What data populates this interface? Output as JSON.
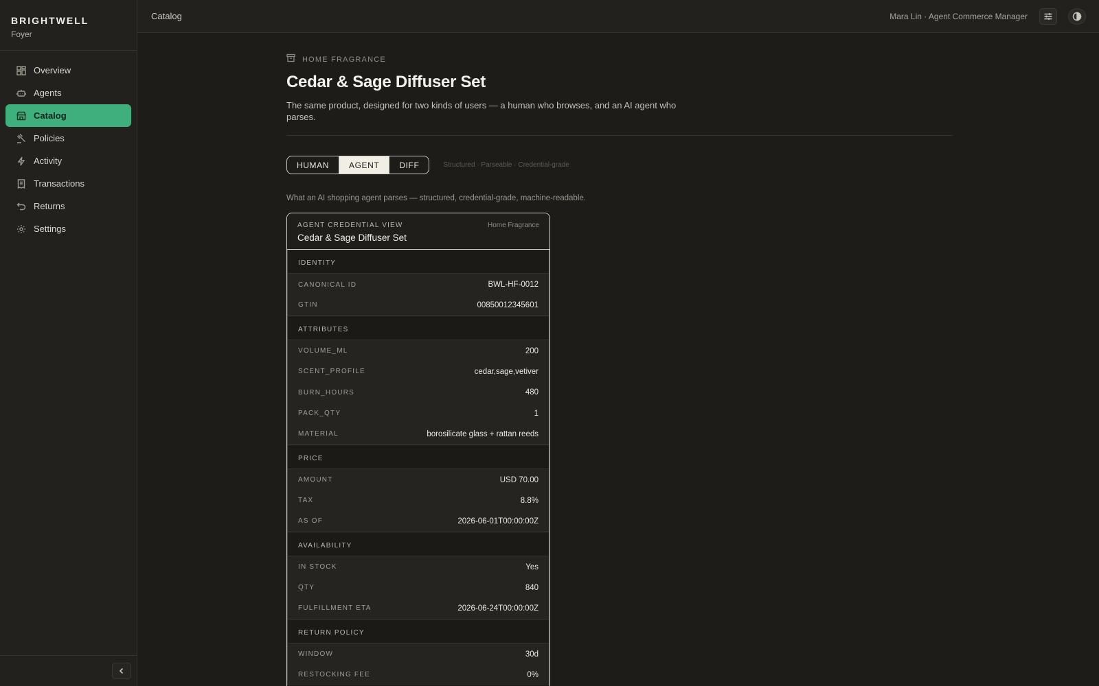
{
  "brand": {
    "name": "BRIGHTWELL",
    "sub": "Foyer"
  },
  "nav": {
    "items": [
      {
        "label": "Overview",
        "icon": "grid-icon"
      },
      {
        "label": "Agents",
        "icon": "robot-icon"
      },
      {
        "label": "Catalog",
        "icon": "storefront-icon",
        "active": true
      },
      {
        "label": "Policies",
        "icon": "gavel-icon"
      },
      {
        "label": "Activity",
        "icon": "bolt-icon"
      },
      {
        "label": "Transactions",
        "icon": "receipt-icon"
      },
      {
        "label": "Returns",
        "icon": "return-arrow-icon"
      },
      {
        "label": "Settings",
        "icon": "gear-icon"
      }
    ]
  },
  "topbar": {
    "breadcrumb": "Catalog",
    "user": "Mara Lin · Agent Commerce Manager"
  },
  "product": {
    "category": "HOME FRAGRANCE",
    "title": "Cedar & Sage Diffuser Set",
    "description": "The same product, designed for two kinds of users — a human who browses, and an AI agent who parses."
  },
  "view_tabs": {
    "tabs": [
      "HUMAN",
      "AGENT",
      "DIFF"
    ],
    "selected": "AGENT",
    "hint": "Structured · Parseable · Credential-grade"
  },
  "caption": "What an AI shopping agent parses — structured, credential-grade, machine-readable.",
  "card": {
    "kicker": "AGENT CREDENTIAL VIEW",
    "title": "Cedar & Sage Diffuser Set",
    "category": "Home Fragrance",
    "sections": {
      "identity": {
        "label": "IDENTITY",
        "rows": [
          {
            "key": "CANONICAL ID",
            "value": "BWL-HF-0012"
          },
          {
            "key": "GTIN",
            "value": "00850012345601"
          }
        ]
      },
      "attributes": {
        "label": "ATTRIBUTES",
        "rows": [
          {
            "key": "VOLUME_ML",
            "value": "200"
          },
          {
            "key": "SCENT_PROFILE",
            "value": "cedar,sage,vetiver"
          },
          {
            "key": "BURN_HOURS",
            "value": "480"
          },
          {
            "key": "PACK_QTY",
            "value": "1"
          },
          {
            "key": "MATERIAL",
            "value": "borosilicate glass + rattan reeds"
          }
        ]
      },
      "price": {
        "label": "PRICE",
        "rows": [
          {
            "key": "AMOUNT",
            "value": "USD 70.00"
          },
          {
            "key": "TAX",
            "value": "8.8%"
          },
          {
            "key": "AS OF",
            "value": "2026-06-01T00:00:00Z"
          }
        ]
      },
      "availability": {
        "label": "AVAILABILITY",
        "rows": [
          {
            "key": "IN STOCK",
            "value": "Yes"
          },
          {
            "key": "QTY",
            "value": "840"
          },
          {
            "key": "FULFILLMENT ETA",
            "value": "2026-06-24T00:00:00Z"
          }
        ]
      },
      "return_policy": {
        "label": "RETURN POLICY",
        "rows": [
          {
            "key": "WINDOW",
            "value": "30d"
          },
          {
            "key": "RESTOCKING FEE",
            "value": "0%"
          }
        ]
      }
    }
  },
  "colors": {
    "accent": "#3fb07d",
    "background": "#1d1c19",
    "sidebar": "#22211e"
  }
}
